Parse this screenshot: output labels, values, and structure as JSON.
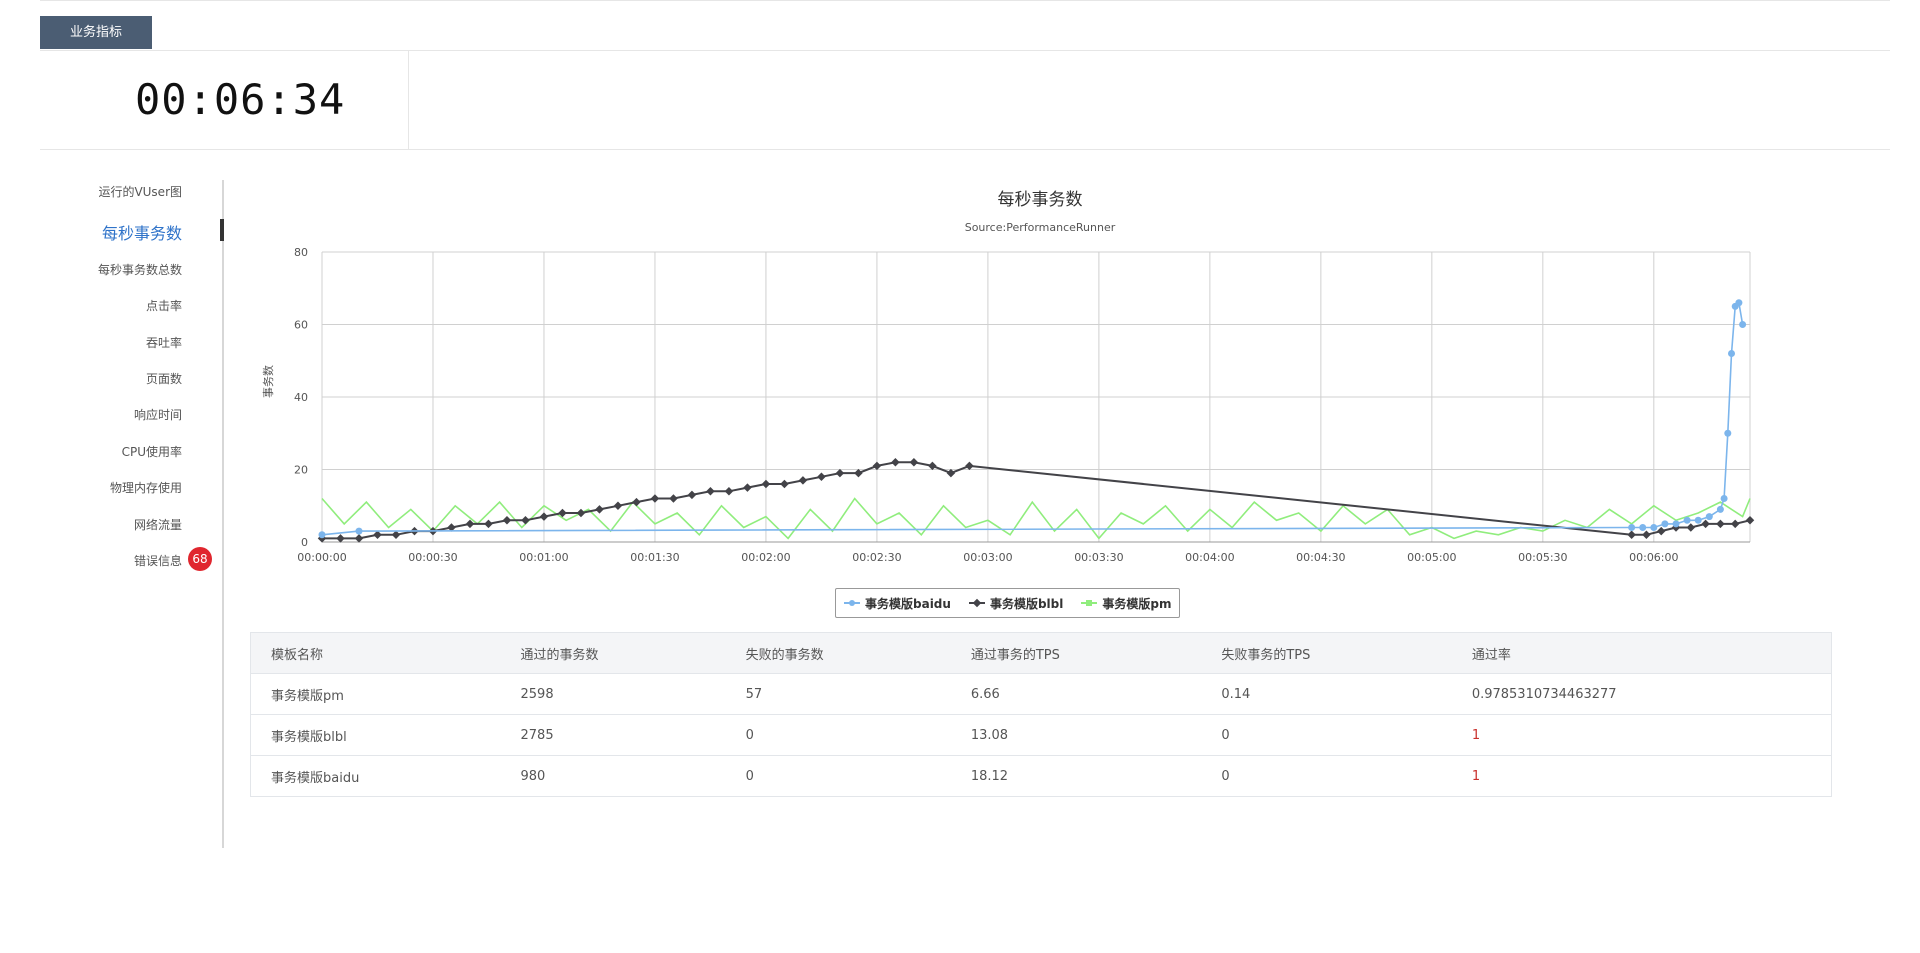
{
  "tabs": [
    {
      "label": "业务指标"
    }
  ],
  "timer": "00:06:34",
  "sidebar": {
    "items": [
      {
        "label": "运行的VUser图"
      },
      {
        "label": "每秒事务数"
      },
      {
        "label": "每秒事务数总数"
      },
      {
        "label": "点击率"
      },
      {
        "label": "吞吐率"
      },
      {
        "label": "页面数"
      },
      {
        "label": "响应时间"
      },
      {
        "label": "CPU使用率"
      },
      {
        "label": "物理内存使用"
      },
      {
        "label": "网络流量"
      },
      {
        "label": "错误信息"
      }
    ],
    "error_count": "68"
  },
  "colors": {
    "baidu": "#7cb5ec",
    "blbl": "#434348",
    "pm": "#90ed7d",
    "tab_bg": "#4b5d73",
    "active": "#2f73c9",
    "badge": "#e0262e"
  },
  "chart_data": {
    "type": "line",
    "title": "每秒事务数",
    "subtitle": "Source:PerformanceRunner",
    "ylabel": "事务数",
    "ylim": [
      0,
      80
    ],
    "yticks": [
      "0",
      "20",
      "40",
      "60",
      "80"
    ],
    "xlim": [
      "00:00:00",
      "00:06:26"
    ],
    "xticks": [
      "00:00:00",
      "00:00:30",
      "00:01:00",
      "00:01:30",
      "00:02:00",
      "00:02:30",
      "00:03:00",
      "00:03:30",
      "00:04:00",
      "00:04:30",
      "00:05:00",
      "00:05:30",
      "00:06:00"
    ],
    "legend_position": "bottom-center",
    "grid": true,
    "series": [
      {
        "name": "事务模版baidu",
        "x_seconds": [
          0,
          10,
          354,
          357,
          360,
          363,
          366,
          369,
          372,
          375,
          378,
          379,
          380,
          381,
          382,
          383,
          384
        ],
        "values": [
          2,
          3,
          4,
          4,
          4,
          5,
          5,
          6,
          6,
          7,
          9,
          12,
          30,
          52,
          65,
          66,
          60
        ]
      },
      {
        "name": "事务模版blbl",
        "x_seconds": [
          0,
          5,
          10,
          15,
          20,
          25,
          30,
          35,
          40,
          45,
          50,
          55,
          60,
          65,
          70,
          75,
          80,
          85,
          90,
          95,
          100,
          105,
          110,
          115,
          120,
          125,
          130,
          135,
          140,
          145,
          150,
          155,
          160,
          165,
          170,
          175,
          354,
          358,
          362,
          366,
          370,
          374,
          378,
          382,
          386
        ],
        "values": [
          1,
          1,
          1,
          2,
          2,
          3,
          3,
          4,
          5,
          5,
          6,
          6,
          7,
          8,
          8,
          9,
          10,
          11,
          12,
          12,
          13,
          14,
          14,
          15,
          16,
          16,
          17,
          18,
          19,
          19,
          21,
          22,
          22,
          21,
          19,
          21,
          2,
          2,
          3,
          4,
          4,
          5,
          5,
          5,
          6
        ]
      },
      {
        "name": "事务模版pm",
        "x_seconds": [
          0,
          6,
          12,
          18,
          24,
          30,
          36,
          42,
          48,
          54,
          60,
          66,
          72,
          78,
          84,
          90,
          96,
          102,
          108,
          114,
          120,
          126,
          132,
          138,
          144,
          150,
          156,
          162,
          168,
          174,
          180,
          186,
          192,
          198,
          204,
          210,
          216,
          222,
          228,
          234,
          240,
          246,
          252,
          258,
          264,
          270,
          276,
          282,
          288,
          294,
          300,
          306,
          312,
          318,
          324,
          330,
          336,
          342,
          348,
          354,
          360,
          366,
          372,
          378,
          384,
          386
        ],
        "values": [
          12,
          5,
          11,
          4,
          9,
          3,
          10,
          5,
          11,
          4,
          10,
          6,
          9,
          3,
          11,
          5,
          8,
          2,
          10,
          4,
          7,
          1,
          9,
          3,
          12,
          5,
          8,
          2,
          10,
          4,
          6,
          2,
          11,
          3,
          9,
          1,
          8,
          5,
          10,
          3,
          9,
          4,
          11,
          6,
          8,
          3,
          10,
          5,
          9,
          2,
          4,
          1,
          3,
          2,
          4,
          3,
          6,
          4,
          9,
          5,
          10,
          6,
          8,
          11,
          7,
          12
        ]
      }
    ]
  },
  "table": {
    "headers": [
      "模板名称",
      "通过的事务数",
      "失败的事务数",
      "通过事务的TPS",
      "失败事务的TPS",
      "通过率"
    ],
    "rows": [
      [
        "事务模版pm",
        "2598",
        "57",
        "6.66",
        "0.14",
        "0.9785310734463277"
      ],
      [
        "事务模版blbl",
        "2785",
        "0",
        "13.08",
        "0",
        "1"
      ],
      [
        "事务模版baidu",
        "980",
        "0",
        "18.12",
        "0",
        "1"
      ]
    ]
  }
}
